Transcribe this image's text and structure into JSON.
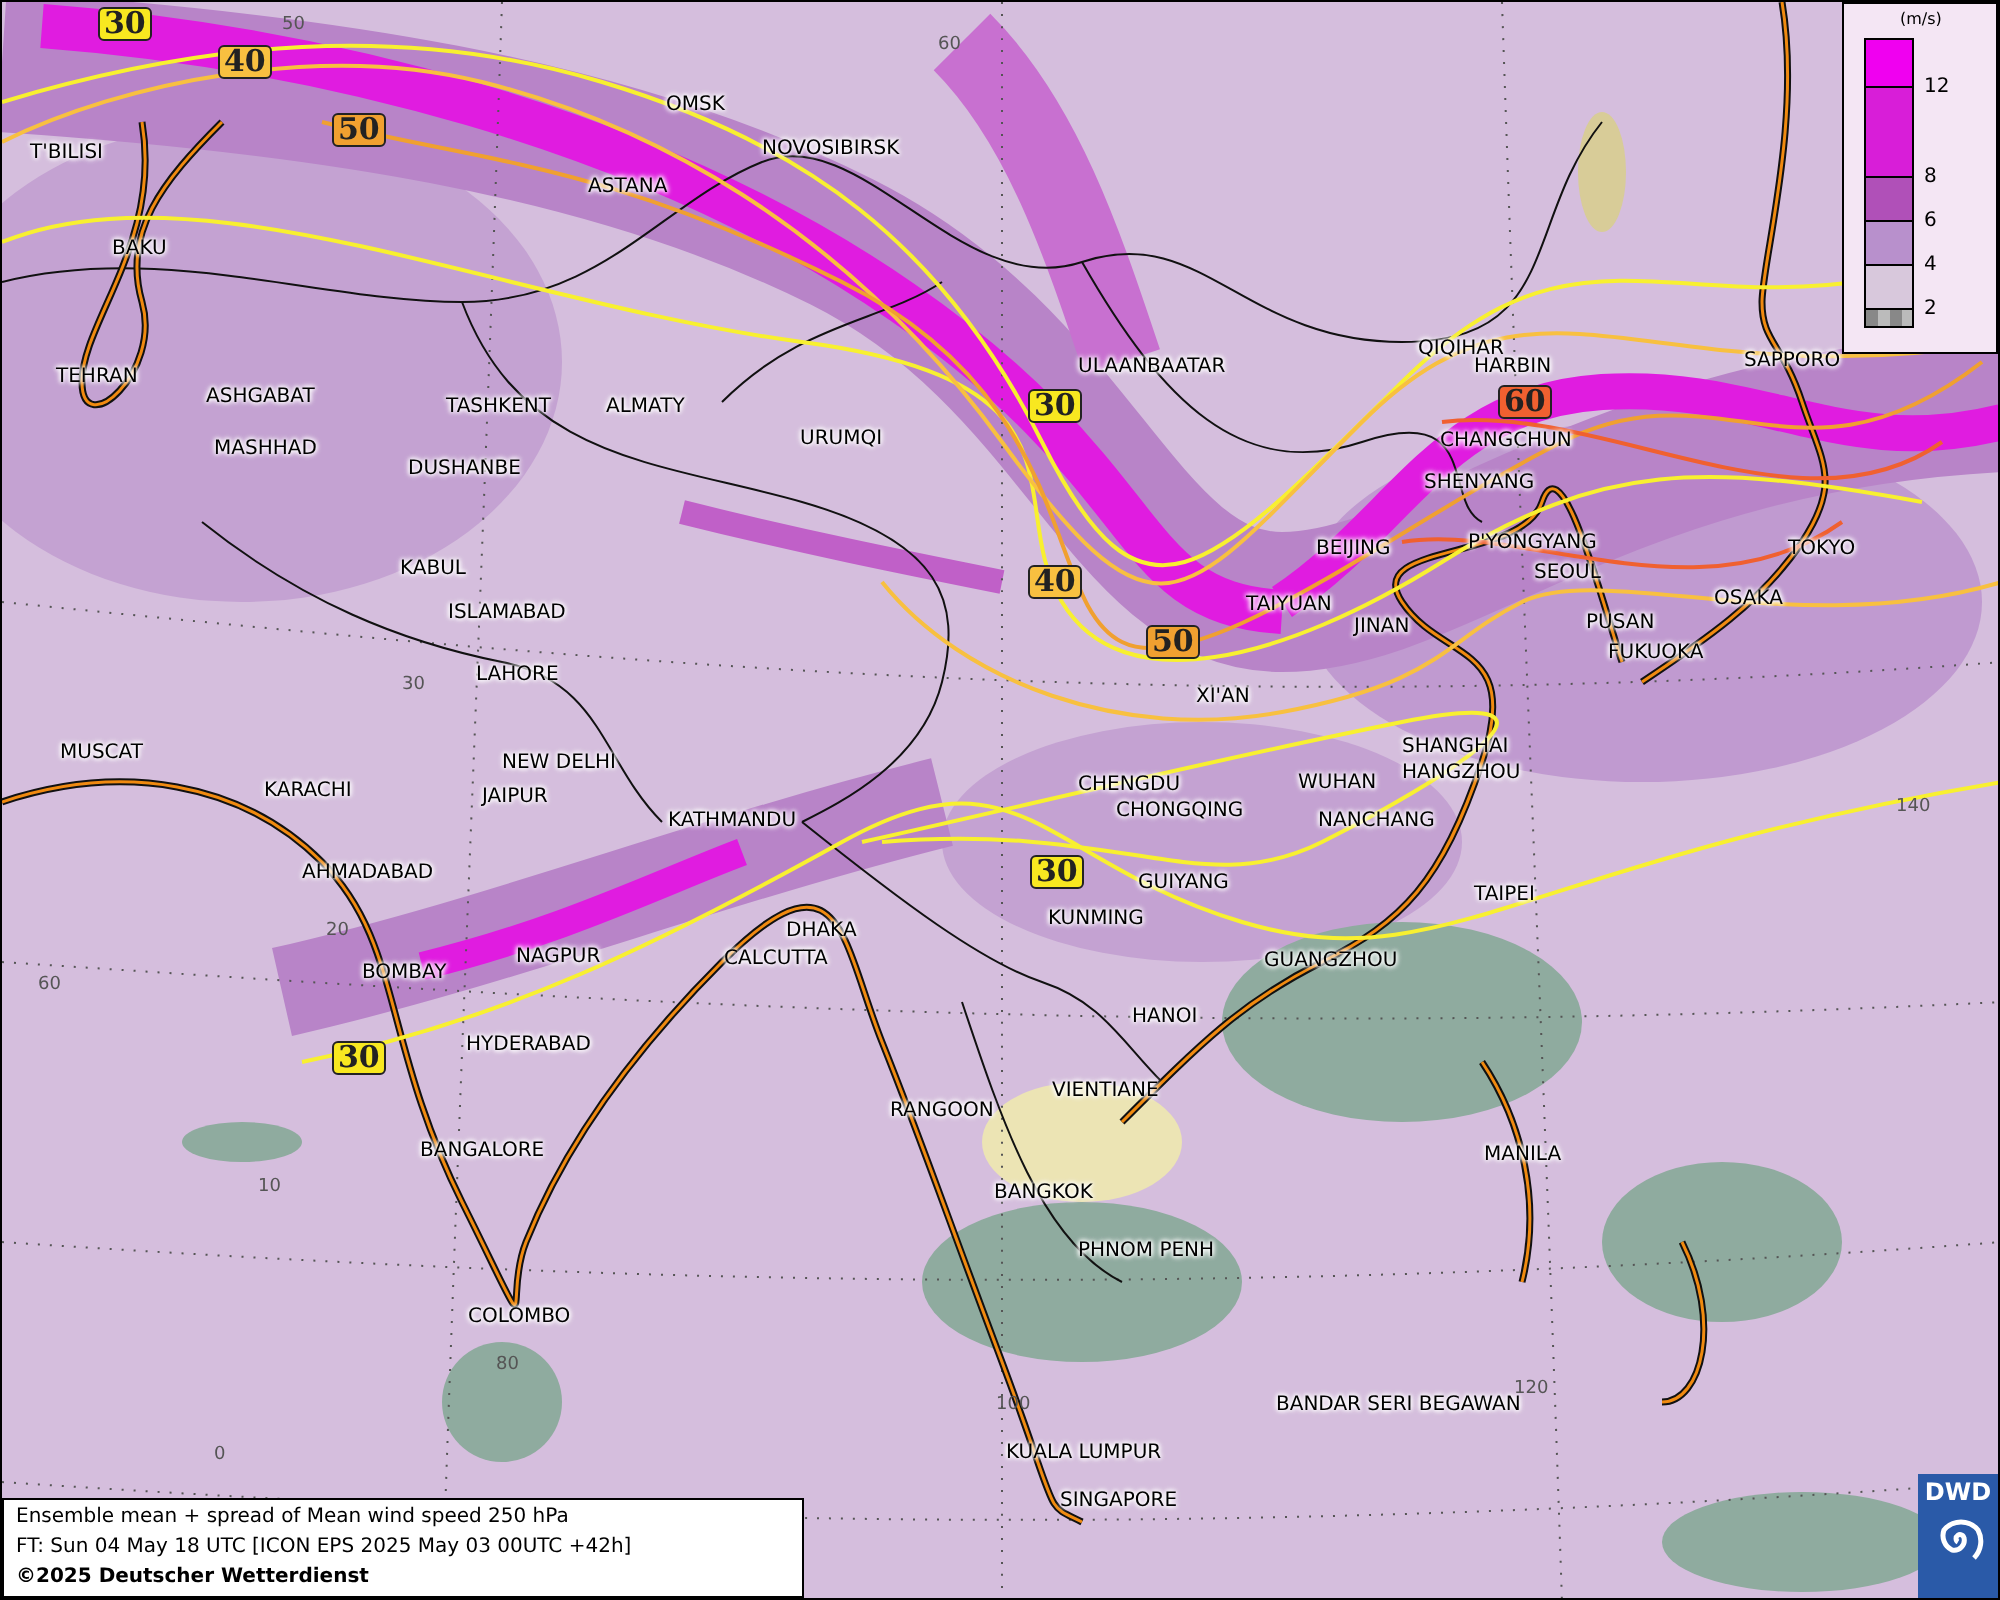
{
  "map": {
    "cities": [
      {
        "name": "OMSK"
      },
      {
        "name": "NOVOSIBIRSK"
      },
      {
        "name": "ASTANA"
      },
      {
        "name": "T'BILISI"
      },
      {
        "name": "BAKU"
      },
      {
        "name": "TEHRAN"
      },
      {
        "name": "ASHGABAT"
      },
      {
        "name": "MASHHAD"
      },
      {
        "name": "TASHKENT"
      },
      {
        "name": "ALMATY"
      },
      {
        "name": "DUSHANBE"
      },
      {
        "name": "URUMQI"
      },
      {
        "name": "ULAANBAATAR"
      },
      {
        "name": "QIQIHAR"
      },
      {
        "name": "HARBIN"
      },
      {
        "name": "CHANGCHUN"
      },
      {
        "name": "SAPPORO"
      },
      {
        "name": "SHENYANG"
      },
      {
        "name": "BEIJING"
      },
      {
        "name": "P'YONGYANG"
      },
      {
        "name": "SEOUL"
      },
      {
        "name": "TOKYO"
      },
      {
        "name": "OSAKA"
      },
      {
        "name": "PUSAN"
      },
      {
        "name": "FUKUOKA"
      },
      {
        "name": "TAIYUAN"
      },
      {
        "name": "JINAN"
      },
      {
        "name": "XI'AN"
      },
      {
        "name": "KABUL"
      },
      {
        "name": "ISLAMABAD"
      },
      {
        "name": "LAHORE"
      },
      {
        "name": "NEW DELHI"
      },
      {
        "name": "JAIPUR"
      },
      {
        "name": "MUSCAT"
      },
      {
        "name": "KARACHI"
      },
      {
        "name": "AHMADABAD"
      },
      {
        "name": "KATHMANDU"
      },
      {
        "name": "CHENGDU"
      },
      {
        "name": "CHONGQING"
      },
      {
        "name": "WUHAN"
      },
      {
        "name": "SHANGHAI"
      },
      {
        "name": "HANGZHOU"
      },
      {
        "name": "NANCHANG"
      },
      {
        "name": "GUIYANG"
      },
      {
        "name": "KUNMING"
      },
      {
        "name": "TAIPEI"
      },
      {
        "name": "GUANGZHOU"
      },
      {
        "name": "BOMBAY"
      },
      {
        "name": "NAGPUR"
      },
      {
        "name": "DHAKA"
      },
      {
        "name": "CALCUTTA"
      },
      {
        "name": "HYDERABAD"
      },
      {
        "name": "HANOI"
      },
      {
        "name": "RANGOON"
      },
      {
        "name": "VIENTIANE"
      },
      {
        "name": "BANGKOK"
      },
      {
        "name": "MANILA"
      },
      {
        "name": "BANGALORE"
      },
      {
        "name": "PHNOM PENH"
      },
      {
        "name": "COLOMBO"
      },
      {
        "name": "BANDAR SERI BEGAWAN"
      },
      {
        "name": "KUALA LUMPUR"
      },
      {
        "name": "SINGAPORE"
      }
    ],
    "contour_labels": [
      {
        "text": "30",
        "color": "#f8e820"
      },
      {
        "text": "40",
        "color": "#f8c040"
      },
      {
        "text": "50",
        "color": "#f0a030"
      },
      {
        "text": "30",
        "color": "#f8e820"
      },
      {
        "text": "40",
        "color": "#f8c040"
      },
      {
        "text": "50",
        "color": "#f0a030"
      },
      {
        "text": "60",
        "color": "#f06030"
      },
      {
        "text": "30",
        "color": "#f8e820"
      },
      {
        "text": "30",
        "color": "#f8e820"
      }
    ],
    "grid_labels": [
      "50",
      "60",
      "30",
      "20",
      "10",
      "0",
      "60",
      "80",
      "100",
      "120",
      "140"
    ]
  },
  "legend": {
    "unit": "(m/s)",
    "ticks": [
      "12",
      "8",
      "6",
      "4",
      "2"
    ]
  },
  "footer": {
    "title": "Ensemble mean + spread of Mean wind speed 250 hPa",
    "forecast_time": "FT: Sun 04 May 18 UTC [ICON EPS 2025 May 03 00UTC +42h]",
    "copyright": "©2025 Deutscher Wetterdienst"
  },
  "logo": {
    "text": "DWD"
  }
}
